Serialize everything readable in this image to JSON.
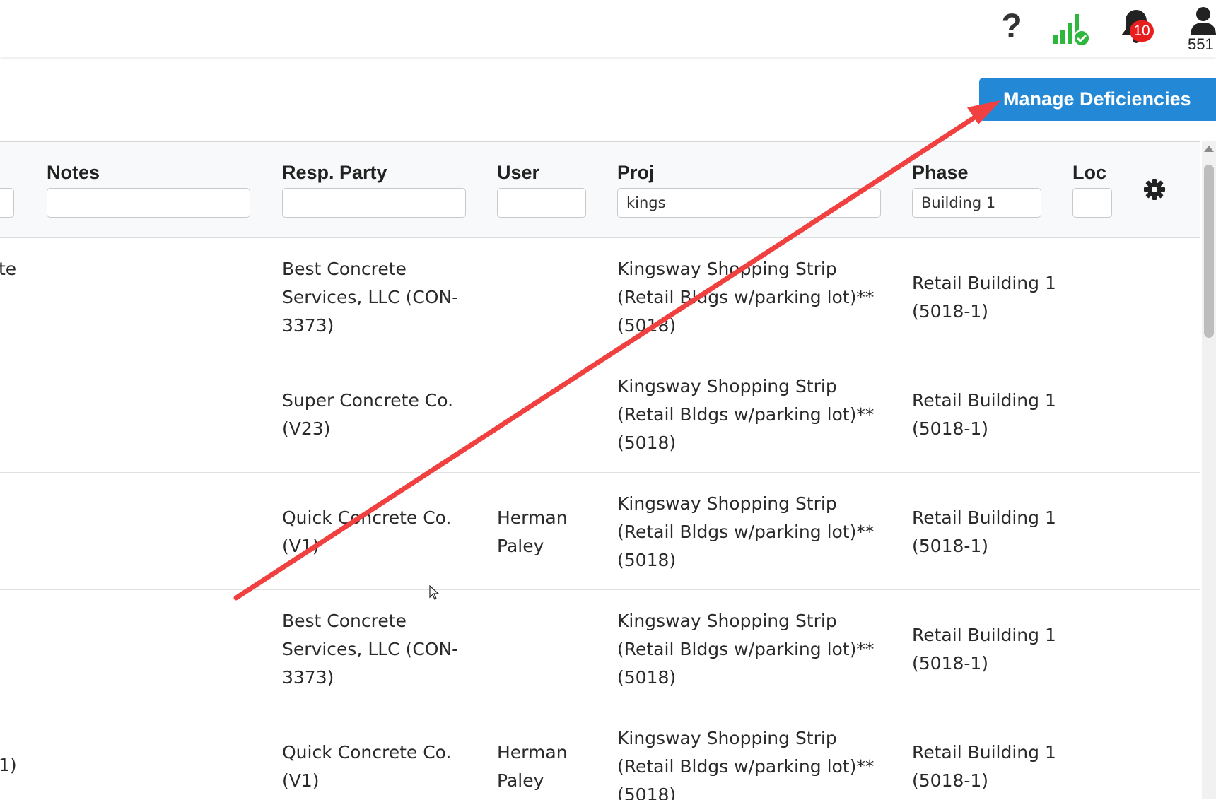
{
  "topbar": {
    "help_icon": "question-mark-icon",
    "signal_icon": "signal-check-icon",
    "notification_icon": "bell-icon",
    "notification_count": "10",
    "user_icon": "user-icon",
    "user_id": "551"
  },
  "toolbar": {
    "manage_label": "Manage Deficiencies"
  },
  "table": {
    "columns": {
      "notes": "Notes",
      "resp_party": "Resp. Party",
      "user": "User",
      "proj": "Proj",
      "phase": "Phase",
      "loc": "Loc"
    },
    "filters": {
      "notes": "",
      "resp_party": "",
      "user": "",
      "proj": "kings",
      "phase": "Building 1",
      "loc": ""
    },
    "rows": [
      {
        "lead": "te",
        "resp_party": "Best Concrete Services, LLC (CON-3373)",
        "user": "",
        "proj": "Kingsway Shopping Strip (Retail Bldgs w/parking lot)** (5018)",
        "phase": "Retail Building 1 (5018-1)"
      },
      {
        "lead": "",
        "resp_party": "Super Concrete Co. (V23)",
        "user": "",
        "proj": "Kingsway Shopping Strip (Retail Bldgs w/parking lot)** (5018)",
        "phase": "Retail Building 1 (5018-1)"
      },
      {
        "lead": "",
        "resp_party": "Quick Concrete Co. (V1)",
        "user": "Herman Paley",
        "proj": "Kingsway Shopping Strip (Retail Bldgs w/parking lot)** (5018)",
        "phase": "Retail Building 1 (5018-1)"
      },
      {
        "lead": "",
        "resp_party": "Best Concrete Services, LLC (CON-3373)",
        "user": "",
        "proj": "Kingsway Shopping Strip (Retail Bldgs w/parking lot)** (5018)",
        "phase": "Retail Building 1 (5018-1)"
      },
      {
        "lead": "1)",
        "resp_party": "Quick Concrete Co. (V1)",
        "user": "Herman Paley",
        "proj": "Kingsway Shopping Strip (Retail Bldgs w/parking lot)** (5018)",
        "phase": "Retail Building 1 (5018-1)"
      }
    ]
  },
  "colors": {
    "primary_button": "#2389d6",
    "badge": "#e81e1e",
    "signal_green": "#2db83d",
    "annotation_arrow": "#f04040"
  }
}
